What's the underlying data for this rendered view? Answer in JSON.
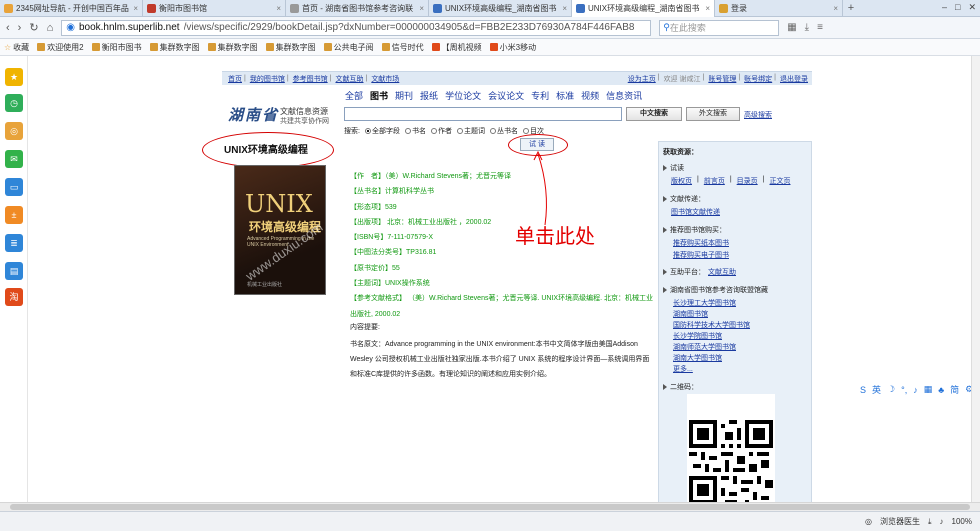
{
  "browser": {
    "tabs": [
      {
        "label": "2345网址导航 - 开创中国百年品",
        "color": "#e8a33a"
      },
      {
        "label": "衡阳市图书馆",
        "color": "#c03a2b"
      },
      {
        "label": "首页 - 湖南省图书馆参考咨询联",
        "color": "#999999"
      },
      {
        "label": "UNIX环境高级编程_湖南省图书",
        "color": "#3a6fc0"
      },
      {
        "label": "UNIX环境高级编程_湖南省图书",
        "color": "#3a6fc0"
      },
      {
        "label": "登录",
        "color": "#d9a030"
      }
    ],
    "active_tab": 4,
    "new_tab": "+",
    "url_domain": "book.hnlm.superlib.net",
    "url_rest": "/views/specific/2929/bookDetail.jsp?dxNumber=000000034905&d=FBB2E233D76930A784F446FAB8",
    "search_text": "在此搜索",
    "favorites": [
      "收藏",
      "欢迎使用2",
      "衡阳市图书",
      "集群数字图",
      "集群数字图",
      "集群数字图",
      "公共电子阅",
      "信号时代",
      "【周机视频",
      "小米3移动"
    ]
  },
  "topnav": {
    "left": [
      "首页",
      "我的图书馆",
      "参考图书馆",
      "文献互助",
      "文献市场"
    ],
    "right": [
      "设为主页",
      "欢迎 谢咸江",
      "账号管理",
      "账号绑定",
      "退出登录"
    ]
  },
  "logo": {
    "calligraphy": "湖南省",
    "line1": "文献信息资源",
    "line2": "共建共享协作网"
  },
  "categories": [
    "全部",
    "图书",
    "期刊",
    "报纸",
    "学位论文",
    "会议论文",
    "专利",
    "标准",
    "视频",
    "信息资讯"
  ],
  "active_category": 1,
  "search": {
    "value": "",
    "btn_cn": "中文搜索",
    "btn_foreign": "外文搜索",
    "advanced": "高级搜索",
    "scope_label": "搜索:",
    "scopes": [
      "全部字段",
      "书名",
      "作者",
      "主题词",
      "丛书名",
      "目次"
    ],
    "scope_selected": 0
  },
  "read_button": "试 读",
  "book": {
    "title": "UNIX环境高级编程",
    "cover": {
      "word": "UNIX",
      "zh": "环境高级编程",
      "en": "Advanced Programming in the UNIX Environment",
      "watermark": "www.duxiu.com",
      "publisher": "机械工业出版社"
    },
    "meta": [
      "【作　者】（美）W.Richard Stevens著；尤晋元等译",
      "【丛书名】计算机科学丛书",
      "【形态项】539",
      "【出版项】 北京：机械工业出版社 ，2000.02",
      "【ISBN号】7-111-07579-X",
      "【中图法分类号】TP316.81",
      "【原书定价】55",
      "【主题词】UNIX操作系统"
    ],
    "citation": "【参考文献格式】 （美）W.Richard Stevens著；尤晋元等译. UNIX环境高级编程. 北京：机械工业出版社, 2000.02",
    "summary_heading": "内容提要:",
    "summary": "书名原文：Advance programming in the UNIX environment:本书中文简体字版由美国Addison Wesley 公司授权机械工业出版社独家出版.本书介绍了 UNIX 系统的程序设计界面—系统调用界面和标准C库提供的许多函数。有理论知识的阐述和应用实例介绍。"
  },
  "annotation": "单击此处",
  "right_panel": {
    "heading": "获取资源：",
    "sections": [
      {
        "title": "试读",
        "links": [
          "版权页",
          "前言页",
          "目录页",
          "正文页"
        ]
      },
      {
        "title": "文献传递：",
        "links": [
          "图书馆文献传递"
        ]
      },
      {
        "title": "推荐图书馆购买：",
        "links": [
          "推荐购买纸本图书",
          "推荐购买电子图书"
        ]
      },
      {
        "title": "互助平台：",
        "links": [
          "文献互助"
        ]
      },
      {
        "title": "湖南省图书馆参考咨询联盟馆藏",
        "links": [
          "长沙理工大学图书馆",
          "湖南图书馆",
          "国防科学技术大学图书馆",
          "长沙学院图书馆",
          "湖南师范大学图书馆",
          "湖南大学图书馆",
          "更多..."
        ]
      },
      {
        "title": "二维码：",
        "links": []
      }
    ]
  },
  "float_toolbar": [
    "英",
    "简"
  ],
  "status": {
    "left": "",
    "browser_doctor": "浏览器医生",
    "zoom": "100%"
  }
}
